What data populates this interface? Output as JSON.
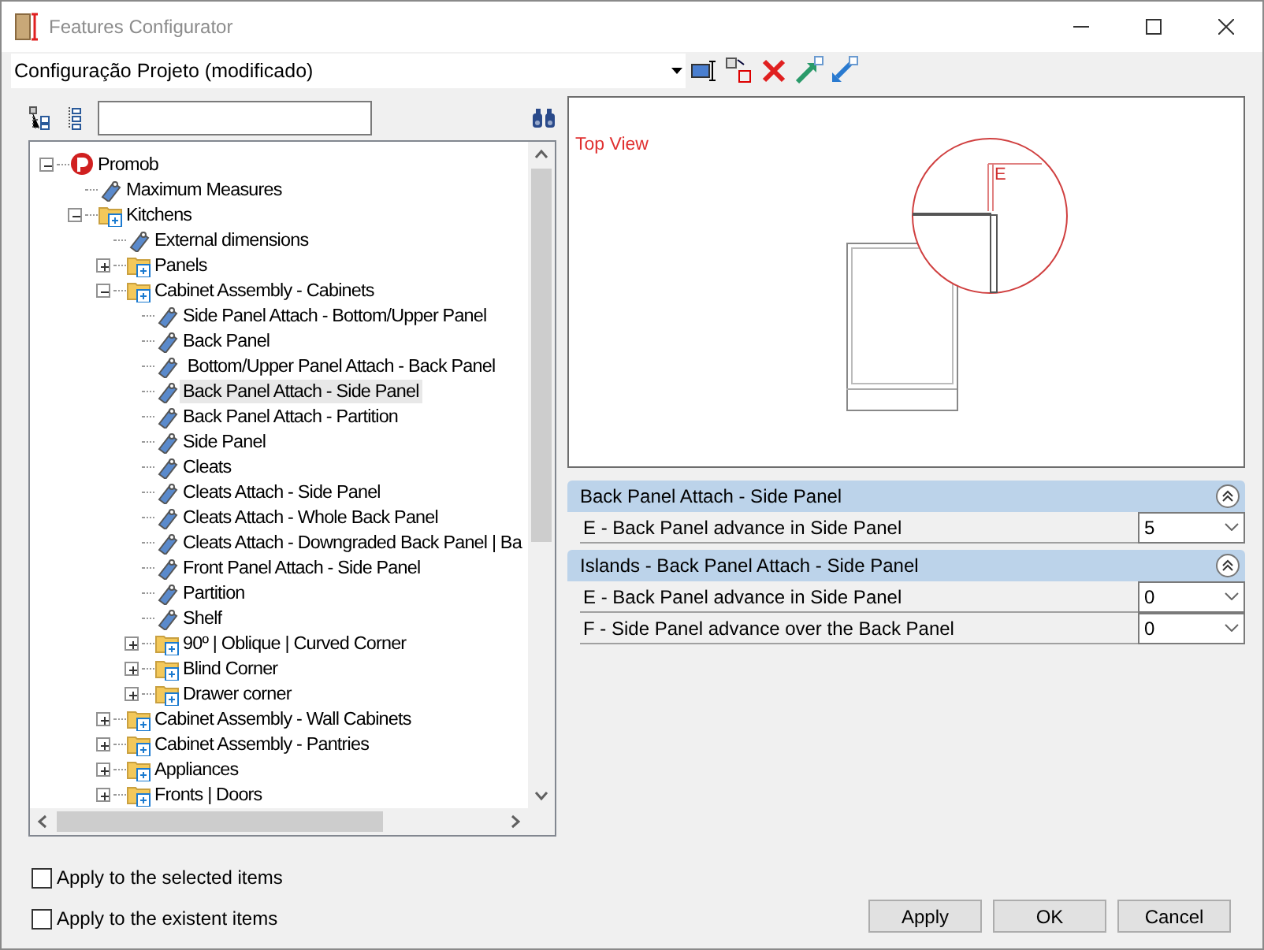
{
  "window": {
    "title": "Features Configurator"
  },
  "configuration": {
    "value": "Configuração Projeto (modificado)"
  },
  "tree": {
    "items": [
      {
        "kind": "root",
        "label": "Promob",
        "expanded": true,
        "selected": false,
        "children": [
          {
            "kind": "feature",
            "label": "Maximum Measures",
            "selected": false
          },
          {
            "kind": "folder",
            "label": "Kitchens",
            "expanded": true,
            "selected": false,
            "children": [
              {
                "kind": "feature",
                "label": "External dimensions",
                "selected": false
              },
              {
                "kind": "folder",
                "label": "Panels",
                "expanded": false,
                "selected": false
              },
              {
                "kind": "folder",
                "label": "Cabinet Assembly - Cabinets",
                "expanded": true,
                "selected": false,
                "children": [
                  {
                    "kind": "feature",
                    "label": "Side Panel Attach - Bottom/Upper Panel",
                    "selected": false
                  },
                  {
                    "kind": "feature",
                    "label": "Back Panel",
                    "selected": false
                  },
                  {
                    "kind": "feature",
                    "label": " Bottom/Upper Panel Attach - Back Panel",
                    "selected": false
                  },
                  {
                    "kind": "feature",
                    "label": "Back Panel Attach - Side Panel",
                    "selected": true
                  },
                  {
                    "kind": "feature",
                    "label": "Back Panel Attach - Partition",
                    "selected": false
                  },
                  {
                    "kind": "feature",
                    "label": "Side Panel",
                    "selected": false
                  },
                  {
                    "kind": "feature",
                    "label": "Cleats",
                    "selected": false
                  },
                  {
                    "kind": "feature",
                    "label": "Cleats Attach - Side Panel",
                    "selected": false
                  },
                  {
                    "kind": "feature",
                    "label": "Cleats Attach - Whole Back Panel",
                    "selected": false
                  },
                  {
                    "kind": "feature",
                    "label": "Cleats Attach - Downgraded Back Panel | Ba",
                    "selected": false
                  },
                  {
                    "kind": "feature",
                    "label": "Front Panel Attach - Side Panel",
                    "selected": false
                  },
                  {
                    "kind": "feature",
                    "label": "Partition",
                    "selected": false
                  },
                  {
                    "kind": "feature",
                    "label": "Shelf",
                    "selected": false
                  },
                  {
                    "kind": "folder",
                    "label": "90º | Oblique | Curved Corner",
                    "expanded": false,
                    "selected": false
                  },
                  {
                    "kind": "folder",
                    "label": "Blind Corner",
                    "expanded": false,
                    "selected": false
                  },
                  {
                    "kind": "folder",
                    "label": "Drawer corner",
                    "expanded": false,
                    "selected": false
                  }
                ]
              },
              {
                "kind": "folder",
                "label": "Cabinet Assembly - Wall Cabinets",
                "expanded": false,
                "selected": false
              },
              {
                "kind": "folder",
                "label": "Cabinet Assembly - Pantries",
                "expanded": false,
                "selected": false
              },
              {
                "kind": "folder",
                "label": "Appliances",
                "expanded": false,
                "selected": false
              },
              {
                "kind": "folder",
                "label": "Fronts | Doors",
                "expanded": false,
                "selected": false
              }
            ]
          }
        ]
      }
    ]
  },
  "preview": {
    "label": "Top View",
    "dimension_label": "E"
  },
  "property_groups": [
    {
      "title": "Back Panel Attach - Side Panel",
      "expanded": true,
      "properties": [
        {
          "label": "E - Back Panel advance in Side Panel",
          "value": "5"
        }
      ]
    },
    {
      "title": "Islands - Back Panel Attach - Side Panel",
      "expanded": true,
      "properties": [
        {
          "label": "E - Back Panel advance in Side Panel",
          "value": "0"
        },
        {
          "label": "F - Side Panel advance over the Back Panel",
          "value": "0"
        }
      ]
    }
  ],
  "options": [
    {
      "label": "Apply to the selected items",
      "checked": false
    },
    {
      "label": "Apply to the existent items",
      "checked": false
    }
  ],
  "buttons": [
    "Apply",
    "OK",
    "Cancel"
  ]
}
